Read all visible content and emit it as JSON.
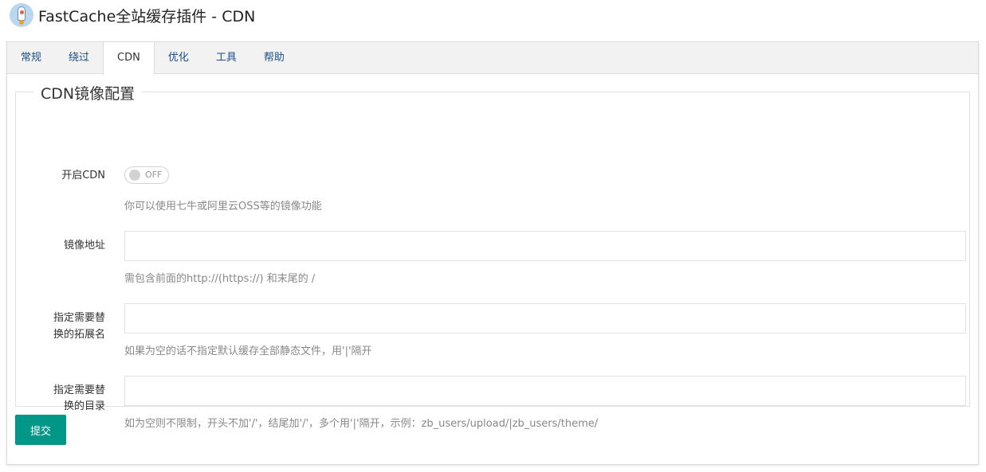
{
  "header": {
    "title": "FastCache全站缓存插件 - CDN"
  },
  "tabs": [
    {
      "label": "常规"
    },
    {
      "label": "绕过"
    },
    {
      "label": "CDN"
    },
    {
      "label": "优化"
    },
    {
      "label": "工具"
    },
    {
      "label": "帮助"
    }
  ],
  "active_tab": "CDN",
  "form": {
    "legend": "CDN镜像配置",
    "enable_cdn": {
      "label": "开启CDN",
      "toggle_state": "OFF",
      "help": "你可以使用七牛或阿里云OSS等的镜像功能"
    },
    "mirror_url": {
      "label": "镜像地址",
      "value": "",
      "help": "需包含前面的http://(https://) 和末尾的 /"
    },
    "extensions": {
      "label_line1": "指定需要替",
      "label_line2": "换的拓展名",
      "value": "",
      "help": "如果为空的话不指定默认缓存全部静态文件，用'|'隔开"
    },
    "directories": {
      "label_line1": "指定需要替",
      "label_line2": "换的目录",
      "value": "",
      "help": "如为空则不限制，开头不加'/'，结尾加'/'，多个用'|'隔开，示例：zb_users/upload/|zb_users/theme/"
    },
    "submit_label": "提交"
  },
  "colors": {
    "accent": "#009688",
    "tab_link": "#1a4e86",
    "tabbar_bg": "#f2f2f2"
  }
}
